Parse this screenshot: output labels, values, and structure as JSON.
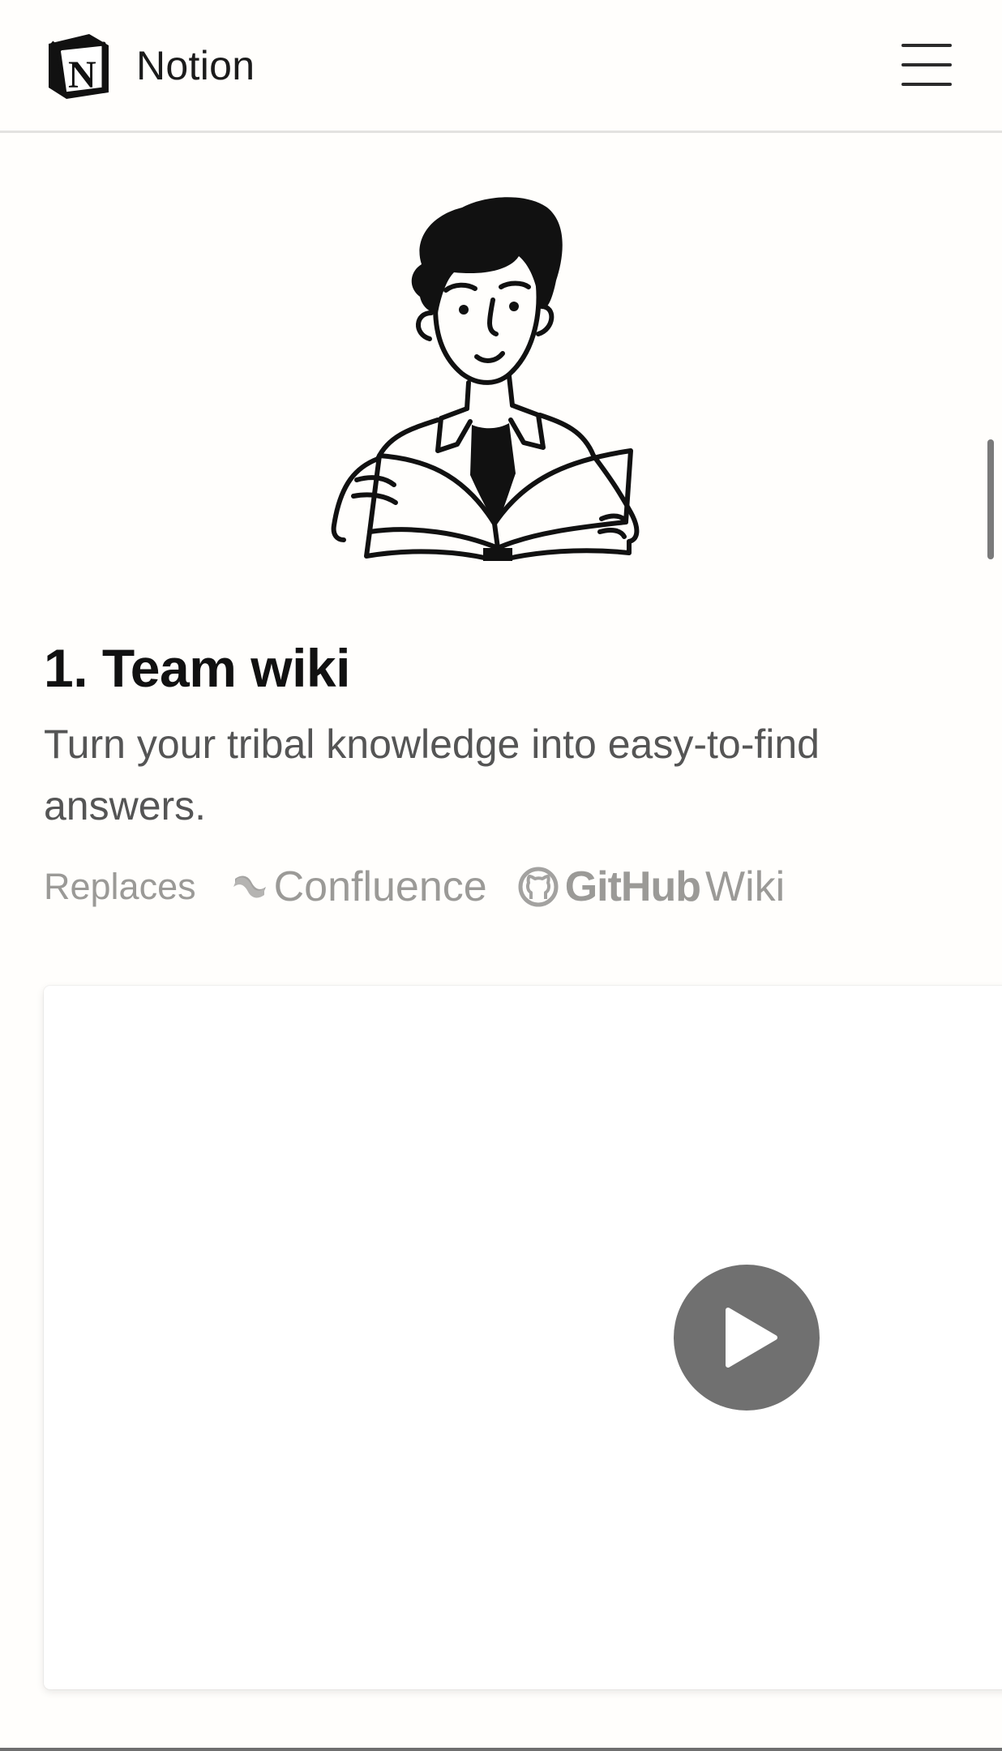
{
  "header": {
    "brand": "Notion",
    "logo_icon": "notion-logo-icon",
    "menu_icon": "hamburger-menu-icon"
  },
  "section": {
    "title": "1. Team wiki",
    "subtitle": "Turn your tribal knowledge into easy-to-find answers.",
    "replaces_label": "Replaces",
    "replaces": [
      {
        "icon": "confluence-icon",
        "name": "Confluence"
      },
      {
        "icon": "github-icon",
        "name_bold": "GitHub",
        "name_light": "Wiki"
      }
    ]
  },
  "video": {
    "play_icon": "play-icon"
  },
  "colors": {
    "background": "#fffefc",
    "muted_text": "#9b9a97",
    "body_text": "#555555",
    "play_button": "#707070"
  }
}
